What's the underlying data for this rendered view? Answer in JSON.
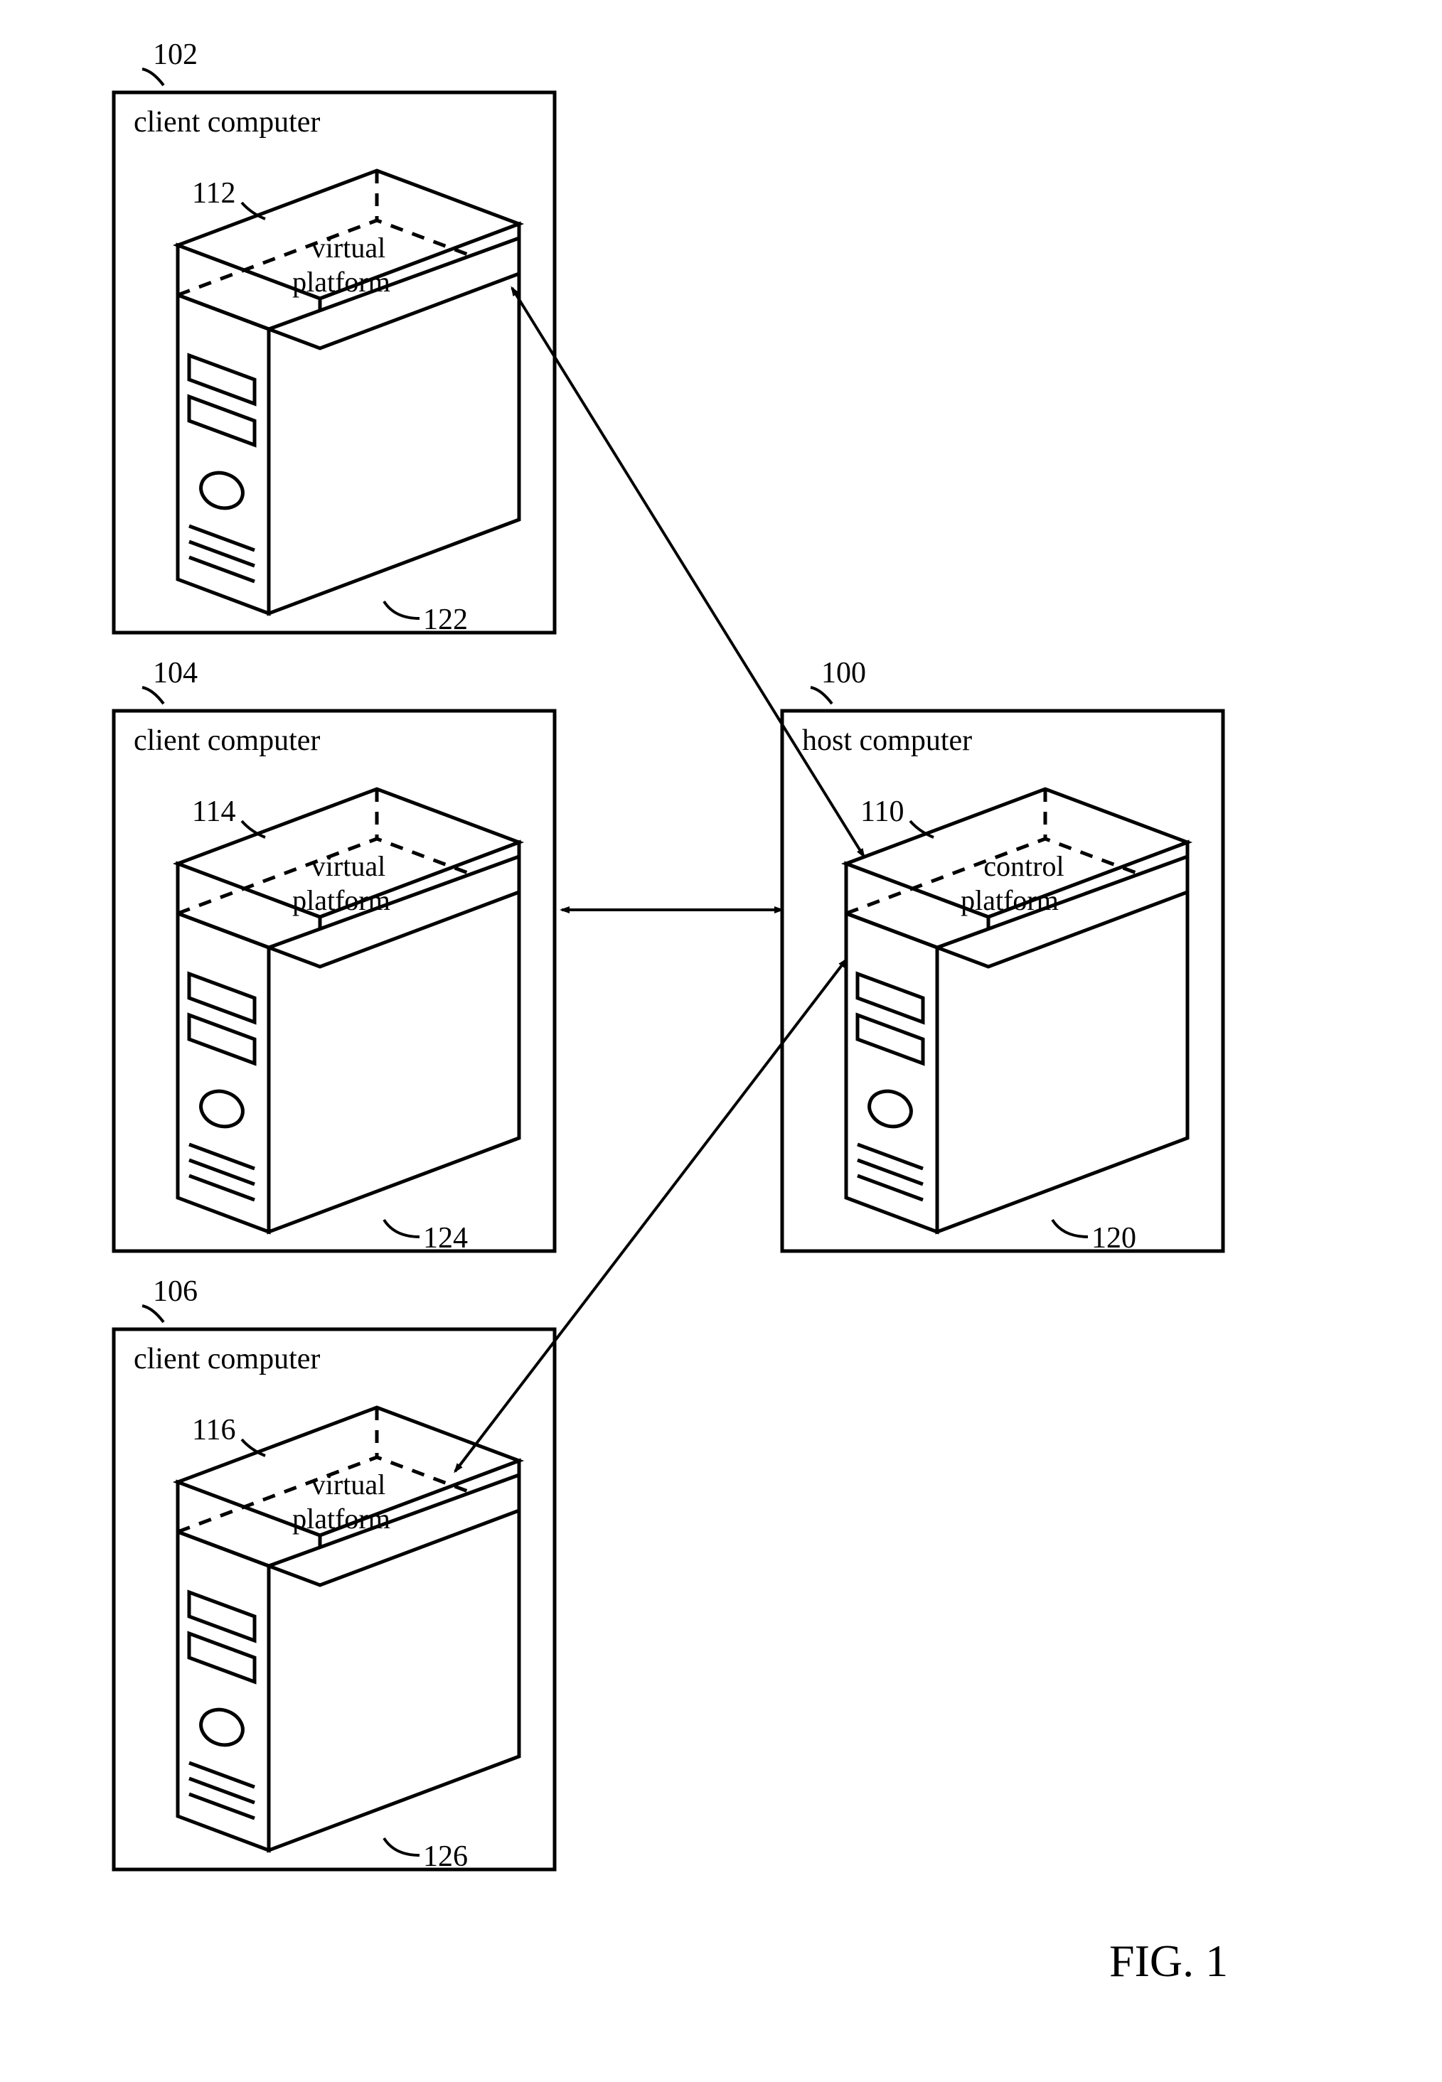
{
  "figure_label": "FIG.  1",
  "host": {
    "ref": "100",
    "title": "host computer",
    "platform_ref": "110",
    "platform_line1": "control",
    "platform_line2": "platform",
    "tower_ref": "120"
  },
  "clients": [
    {
      "ref": "102",
      "title": "client computer",
      "platform_ref": "112",
      "platform_line1": "virtual",
      "platform_line2": "platform",
      "tower_ref": "122"
    },
    {
      "ref": "104",
      "title": "client computer",
      "platform_ref": "114",
      "platform_line1": "virtual",
      "platform_line2": "platform",
      "tower_ref": "124"
    },
    {
      "ref": "106",
      "title": "client computer",
      "platform_ref": "116",
      "platform_line1": "virtual",
      "platform_line2": "platform",
      "tower_ref": "126"
    }
  ]
}
